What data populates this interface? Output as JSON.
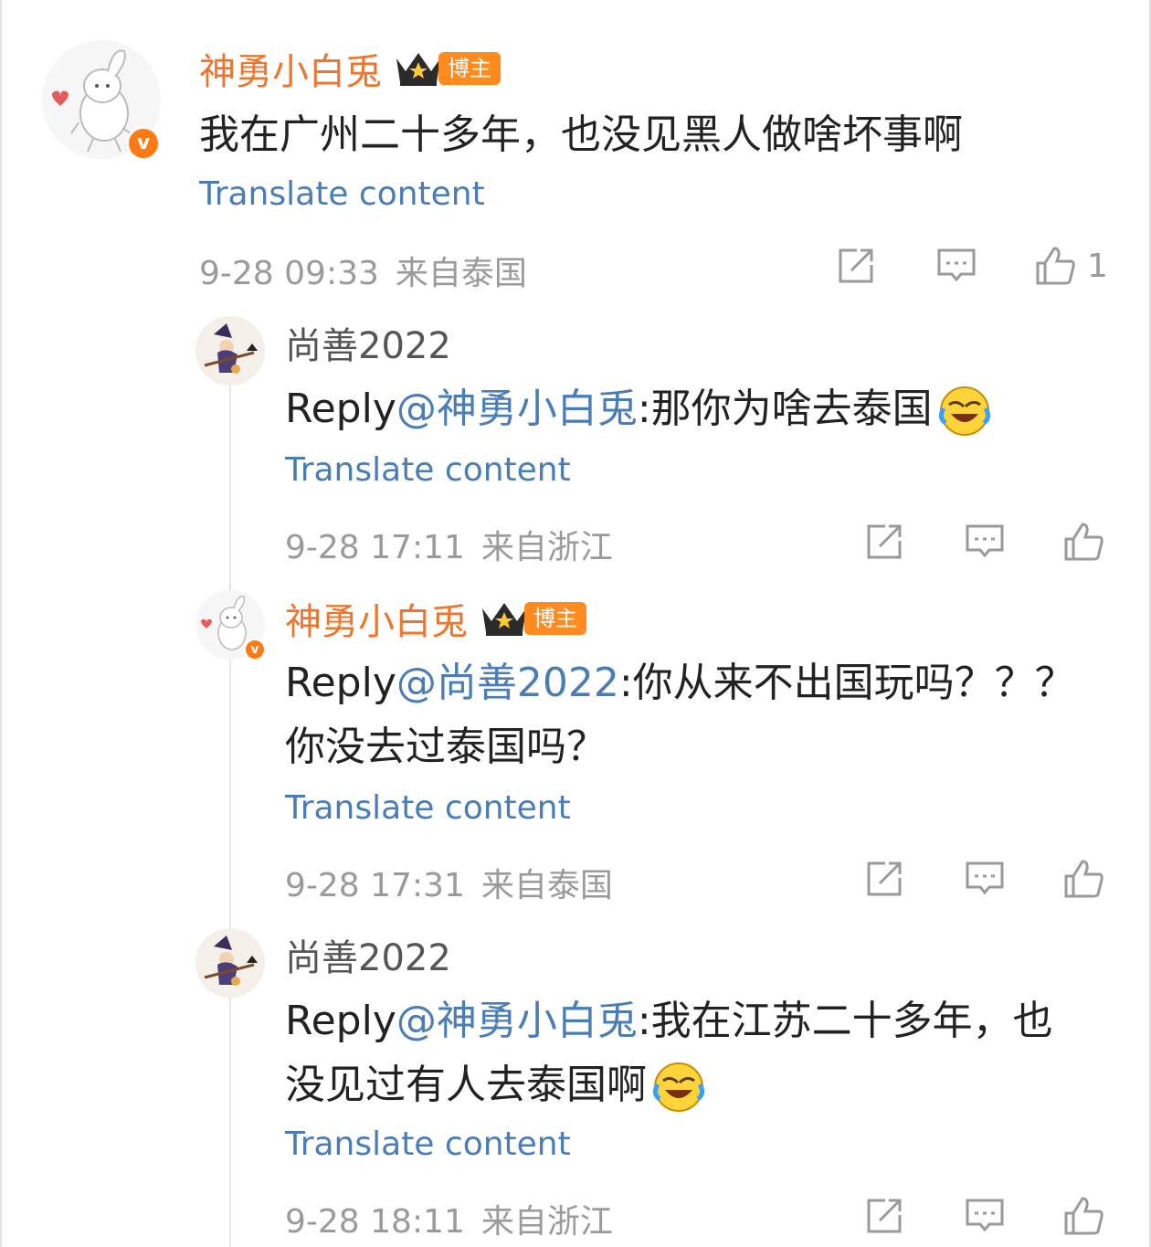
{
  "comment_main": {
    "username": "神勇小白兎",
    "badge_label": "博主",
    "text": "我在广州二十多年，也没见黑人做啥坏事啊",
    "translate_label": "Translate content",
    "date": "9-28 09:33",
    "location": "来自泰国",
    "like_count": "1"
  },
  "replies": [
    {
      "username": "尚善2022",
      "reply_prefix": "Reply",
      "mention": "@神勇小白兎",
      "text_line1": ":那你为啥去泰国",
      "translate_label": "Translate content",
      "date": "9-28 17:11",
      "location": "来自浙江"
    },
    {
      "username": "神勇小白兎",
      "badge_label": "博主",
      "reply_prefix": "Reply",
      "mention": "@尚善2022",
      "text_line1": ":你从来不出国玩吗？？？",
      "text_line2": "你没去过泰国吗？",
      "translate_label": "Translate content",
      "date": "9-28 17:31",
      "location": "来自泰国"
    },
    {
      "username": "尚善2022",
      "reply_prefix": "Reply",
      "mention": "@神勇小白兎",
      "text_line1": ":我在江苏二十多年，也",
      "text_line2": "没见过有人去泰国啊",
      "translate_label": "Translate content",
      "date": "9-28 18:11",
      "location": "来自浙江"
    }
  ],
  "icons": {
    "share": "share-icon",
    "comment": "comment-icon",
    "like": "thumbs-up-icon",
    "verified": "verified-v-icon",
    "crown": "crown-icon",
    "emoji": "laughing-crying-emoji"
  },
  "colors": {
    "username_accent": "#f0752a",
    "link_blue": "#4a7db8",
    "meta_gray": "#9a9a9a",
    "badge_orange": "#ff8a1e"
  }
}
